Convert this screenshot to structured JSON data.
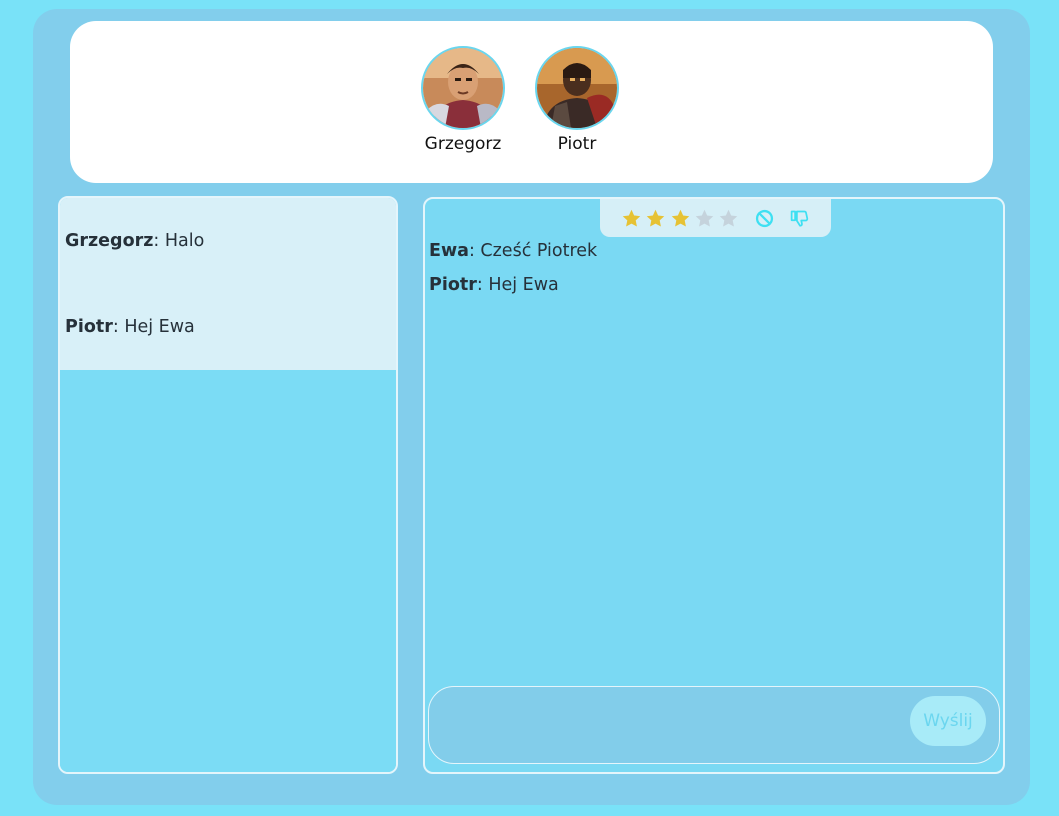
{
  "contacts": [
    {
      "name": "Grzegorz",
      "avatar_icon": "warrior-portrait"
    },
    {
      "name": "Piotr",
      "avatar_icon": "armored-knight-portrait"
    }
  ],
  "left_chat": {
    "messages": [
      {
        "author": "Grzegorz",
        "separator": ":",
        "text": " Halo"
      },
      {
        "author": "Piotr",
        "separator": ":",
        "text": " Hej Ewa"
      }
    ]
  },
  "right_chat": {
    "rating": {
      "value": 3,
      "max": 5,
      "filled_color": "#e6c234",
      "empty_color": "#c5d3dc"
    },
    "toolbar_icons": [
      "block-icon",
      "thumbs-down-icon"
    ],
    "icon_color": "#3ee0f2",
    "messages": [
      {
        "author": "Ewa",
        "separator": ":",
        "text": " Cześć Piotrek"
      },
      {
        "author": "Piotr",
        "separator": ":",
        "text": " Hej Ewa"
      }
    ],
    "compose": {
      "placeholder": "",
      "value": "",
      "send_label": "Wyślij"
    }
  },
  "colors": {
    "page_background": "#79e2f8",
    "frame_background": "#82ceec",
    "accent": "#6bd6ef"
  }
}
